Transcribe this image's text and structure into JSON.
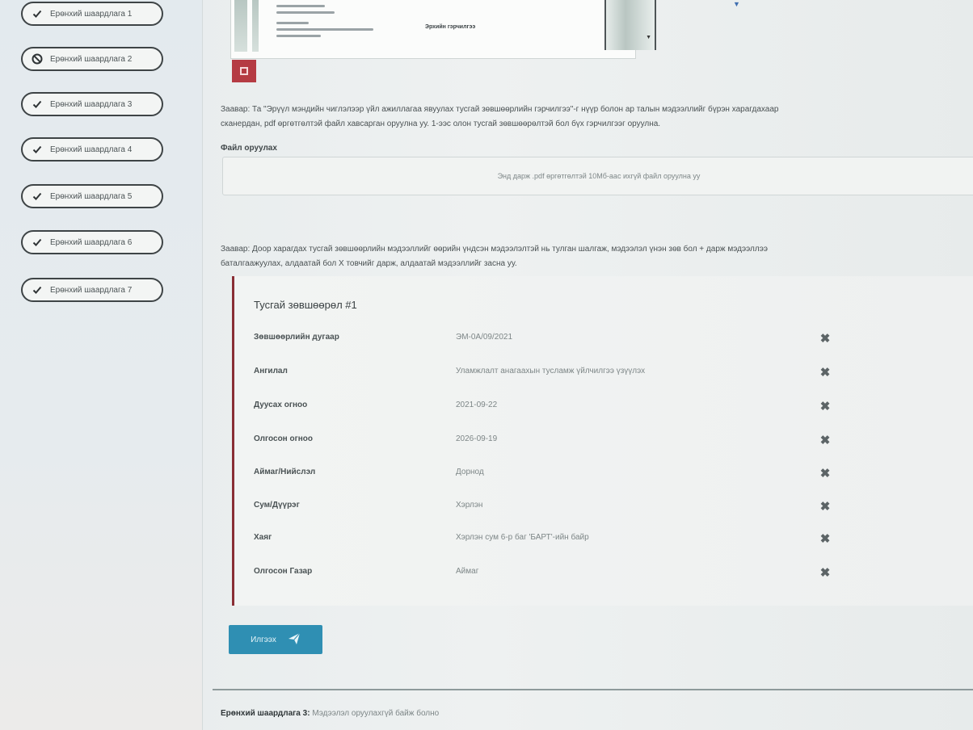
{
  "sidebar": {
    "items": [
      {
        "label": "Ерөнхий шаардлага 1",
        "status": "done"
      },
      {
        "label": "Ерөнхий шаардлага 2",
        "status": "blocked"
      },
      {
        "label": "Ерөнхий шаардлага 3",
        "status": "done"
      },
      {
        "label": "Ерөнхий шаардлага 4",
        "status": "done"
      },
      {
        "label": "Ерөнхий шаардлага 5",
        "status": "done"
      },
      {
        "label": "Ерөнхий шаардлага 6",
        "status": "done"
      },
      {
        "label": "Ерөнхий шаардлага 7",
        "status": "done"
      }
    ]
  },
  "doc_preview": {
    "caption": "Эрхийн гэрчилгээ"
  },
  "note1": {
    "line1": "Заавар: Та \"Эрүүл мэндийн чиглэлээр үйл ажиллагаа явуулах тусгай зөвшөөрлийн гэрчилгээ\"-г нүүр болон ар талын мэдээллийг бүрэн харагдахаар",
    "line2": "сканердан, pdf өргөтгөлтэй файл хавсарган оруулна уу. 1-ээс олон тусгай зөвшөөрөлтэй бол бүх гэрчилгээг оруулна."
  },
  "upload": {
    "label": "Файл оруулах",
    "placeholder": "Энд дарж .pdf өргөтгөлтэй 10Мб-аас ихгүй файл оруулна уу"
  },
  "note2": {
    "line1": "Заавар: Доор харагдах тусгай зөвшөөрлийн мэдээллийг өөрийн үндсэн мэдээлэлтэй нь тулган шалгаж, мэдээлэл үнэн зөв бол + дарж мэдээллээ",
    "line2": "баталгаажуулах, алдаатай бол X товчийг дарж, алдаатай мэдээллийг засна уу."
  },
  "permit": {
    "title": "Тусгай зөвшөөрөл #1",
    "rows": [
      {
        "key": "Зөвшөөрлийн дугаар",
        "value": "ЭМ-0А/09/2021"
      },
      {
        "key": "Ангилал",
        "value": "Уламжлалт анагаахын тусламж үйлчилгээ үзүүлэх"
      },
      {
        "key": "Дуусах огноо",
        "value": "2021-09-22"
      },
      {
        "key": "Олгосон огноо",
        "value": "2026-09-19"
      },
      {
        "key": "Аймаг/Нийслэл",
        "value": "Дорнод"
      },
      {
        "key": "Сум/Дүүрэг",
        "value": "Хэрлэн"
      },
      {
        "key": "Хаяг",
        "value": "Хэрлэн сум 6-р баг 'БАРТ'-ийн байр"
      },
      {
        "key": "Олгосон Газар",
        "value": "Аймаг"
      }
    ]
  },
  "send_button": {
    "label": "Илгээх"
  },
  "footer": {
    "title": "Ерөнхий шаардлага 3:",
    "rest": " Мэдээлэл оруулахгүй байж болно"
  },
  "colors": {
    "accent_blue": "#2f8fb3",
    "card_border": "#8a2e35",
    "remove_red": "#b53b43"
  }
}
